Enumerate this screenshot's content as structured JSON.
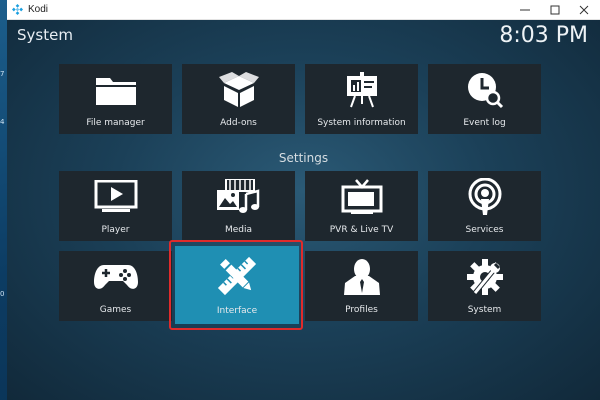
{
  "window": {
    "title": "Kodi",
    "controls": {
      "minimize": "minimize-icon",
      "maximize": "maximize-icon",
      "close": "close-icon"
    }
  },
  "desktop_edge_glyphs": [
    "7",
    "4",
    "0"
  ],
  "header": {
    "title": "System",
    "clock": "8:03 PM"
  },
  "system_tiles": [
    {
      "label": "File manager",
      "icon": "folder-icon"
    },
    {
      "label": "Add-ons",
      "icon": "open-box-icon"
    },
    {
      "label": "System information",
      "icon": "presentation-board-icon"
    },
    {
      "label": "Event log",
      "icon": "clock-search-icon"
    }
  ],
  "settings_label": "Settings",
  "settings_tiles": [
    {
      "label": "Player",
      "icon": "monitor-play-icon"
    },
    {
      "label": "Media",
      "icon": "film-photo-music-icon"
    },
    {
      "label": "PVR & Live TV",
      "icon": "tv-icon"
    },
    {
      "label": "Services",
      "icon": "broadcast-icon"
    },
    {
      "label": "Games",
      "icon": "gamepad-icon"
    },
    {
      "label": "Interface",
      "icon": "pencil-ruler-icon",
      "selected": true
    },
    {
      "label": "Profiles",
      "icon": "person-icon"
    },
    {
      "label": "System",
      "icon": "gear-wrench-icon"
    }
  ],
  "colors": {
    "tile": "#1e272e",
    "selected_tile": "#1f8fb3",
    "highlight_border": "#e02b2b",
    "kodi_logo": "#1a9fe0"
  }
}
